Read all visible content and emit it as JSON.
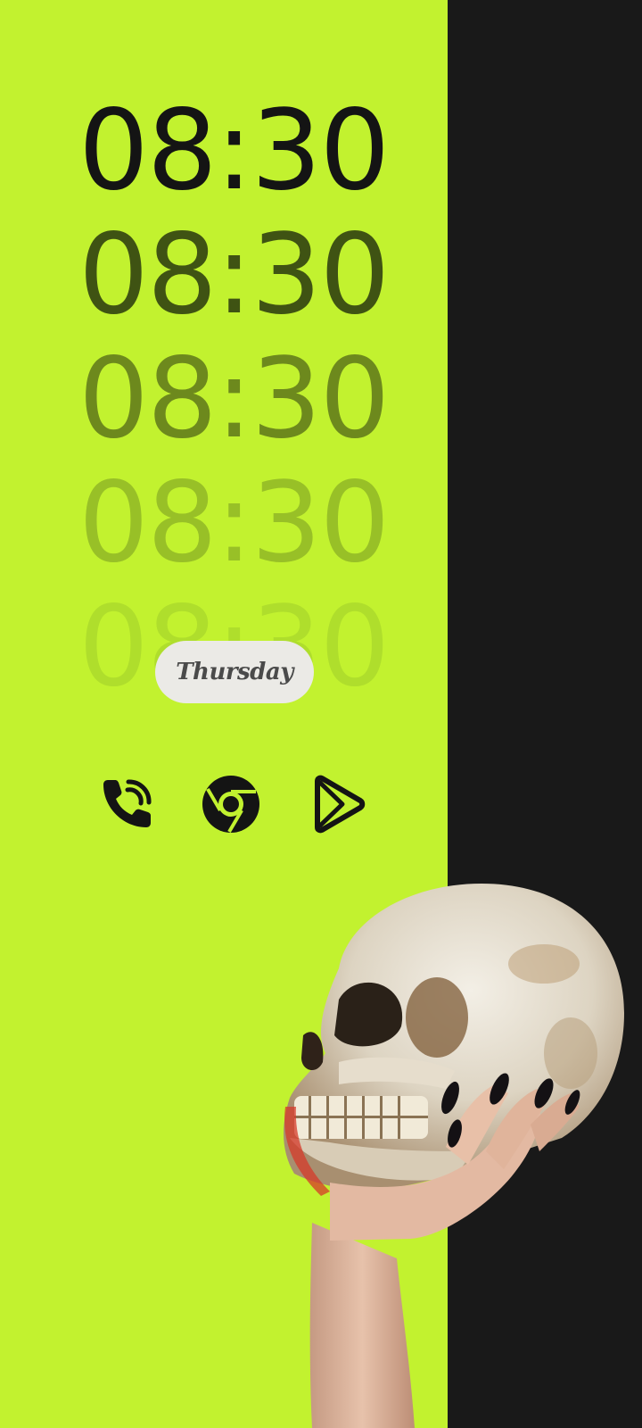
{
  "clock": {
    "lines": [
      "08:30",
      "08:30",
      "08:30",
      "08:30",
      "08:30"
    ]
  },
  "date": {
    "day": "Thursday"
  },
  "dock": {
    "icons": [
      "phone-icon",
      "chrome-icon",
      "play-store-icon"
    ]
  },
  "colors": {
    "background": "#c2f22f",
    "dark_panel": "#191919",
    "pill": "#ebeae6",
    "icon": "#141414"
  },
  "wallpaper": {
    "subject": "hand-holding-skull"
  }
}
